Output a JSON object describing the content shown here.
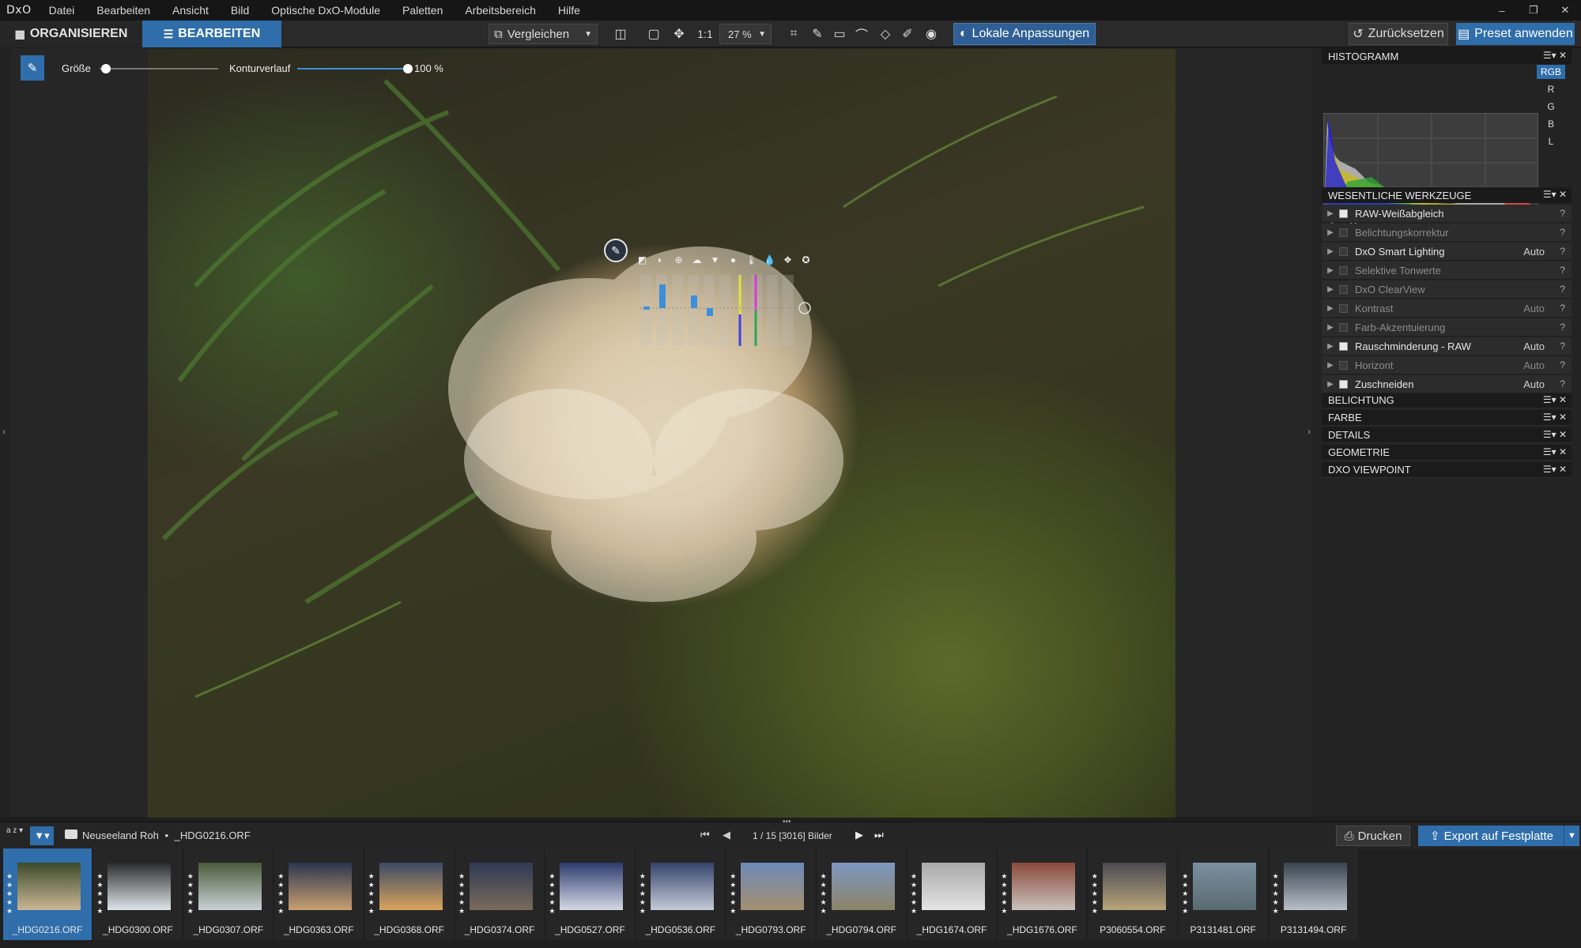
{
  "app": {
    "logo": "DxO"
  },
  "menu": [
    "Datei",
    "Bearbeiten",
    "Ansicht",
    "Bild",
    "Optische DxO-Module",
    "Paletten",
    "Arbeitsbereich",
    "Hilfe"
  ],
  "window_controls": [
    "–",
    "❐",
    "✕"
  ],
  "tabs": {
    "organize": "ORGANISIEREN",
    "edit": "BEARBEITEN"
  },
  "toolbar": {
    "compare": "Vergleichen",
    "one_to_one": "1:1",
    "zoom": "27 %",
    "local_adjustments": "Lokale Anpassungen",
    "reset": "Zurücksetzen",
    "apply_preset": "Preset anwenden"
  },
  "brush": {
    "size_label": "Größe",
    "feather_label": "Konturverlauf",
    "feather_value": "100 %",
    "size_level": 0.05,
    "feather_level": 1.0
  },
  "histogram": {
    "title": "HISTOGRAMM",
    "channels": [
      "RGB",
      "R",
      "G",
      "B",
      "L"
    ],
    "selected_channel": "RGB"
  },
  "essential_tools": {
    "title": "WESENTLICHE WERKZEUGE",
    "items": [
      {
        "label": "RAW-Weißabgleich",
        "enabled": true,
        "auto": ""
      },
      {
        "label": "Belichtungskorrektur",
        "enabled": false,
        "auto": ""
      },
      {
        "label": "DxO Smart Lighting",
        "enabled": false,
        "auto": "Auto"
      },
      {
        "label": "Selektive Tonwerte",
        "enabled": false,
        "auto": ""
      },
      {
        "label": "DxO ClearView",
        "enabled": false,
        "auto": ""
      },
      {
        "label": "Kontrast",
        "enabled": false,
        "auto": "Auto"
      },
      {
        "label": "Farb-Akzentuierung",
        "enabled": false,
        "auto": ""
      },
      {
        "label": "Rauschminderung - RAW",
        "enabled": true,
        "auto": "Auto"
      },
      {
        "label": "Horizont",
        "enabled": false,
        "auto": "Auto"
      },
      {
        "label": "Zuschneiden",
        "enabled": true,
        "auto": "Auto"
      }
    ]
  },
  "sections": [
    "BELICHTUNG",
    "FARBE",
    "DETAILS",
    "GEOMETRIE",
    "DXO VIEWPOINT"
  ],
  "filmbar": {
    "sort": "a z",
    "path_folder": "Neuseeland Roh",
    "path_sep": "•",
    "path_file": "_HDG0216.ORF",
    "counter": "1 / 15 [3016] Bilder",
    "print": "Drucken",
    "export": "Export auf Festplatte"
  },
  "thumbnails": [
    {
      "name": "_HDG0216.ORF",
      "selected": true,
      "c1": "#3b4a2a",
      "c2": "#cbb794"
    },
    {
      "name": "_HDG0300.ORF",
      "selected": false,
      "c1": "#2a2a2a",
      "c2": "#dfe6ea"
    },
    {
      "name": "_HDG0307.ORF",
      "selected": false,
      "c1": "#4a5a3a",
      "c2": "#c9d2d6"
    },
    {
      "name": "_HDG0363.ORF",
      "selected": false,
      "c1": "#2a3550",
      "c2": "#c9a070"
    },
    {
      "name": "_HDG0368.ORF",
      "selected": false,
      "c1": "#3b4a66",
      "c2": "#d9a35c"
    },
    {
      "name": "_HDG0374.ORF",
      "selected": false,
      "c1": "#2e3a56",
      "c2": "#7a6a5a"
    },
    {
      "name": "_HDG0527.ORF",
      "selected": false,
      "c1": "#2d3b6e",
      "c2": "#d5d9e6"
    },
    {
      "name": "_HDG0536.ORF",
      "selected": false,
      "c1": "#34436a",
      "c2": "#c4ccd9"
    },
    {
      "name": "_HDG0793.ORF",
      "selected": false,
      "c1": "#6d89b8",
      "c2": "#a49070"
    },
    {
      "name": "_HDG0794.ORF",
      "selected": false,
      "c1": "#7e98c2",
      "c2": "#8b8366"
    },
    {
      "name": "_HDG1674.ORF",
      "selected": false,
      "c1": "#a8a8a8",
      "c2": "#e4e4e4"
    },
    {
      "name": "_HDG1676.ORF",
      "selected": false,
      "c1": "#8a4a3a",
      "c2": "#c9c2bd"
    },
    {
      "name": "P3060554.ORF",
      "selected": false,
      "c1": "#4a4a52",
      "c2": "#b8a37a"
    },
    {
      "name": "P3131481.ORF",
      "selected": false,
      "c1": "#7a8fa0",
      "c2": "#5a6a70"
    },
    {
      "name": "P3131494.ORF",
      "selected": false,
      "c1": "#3a4450",
      "c2": "#b8c0c8"
    }
  ],
  "colors": {
    "accent": "#2f6eaa",
    "panel": "#232323"
  }
}
